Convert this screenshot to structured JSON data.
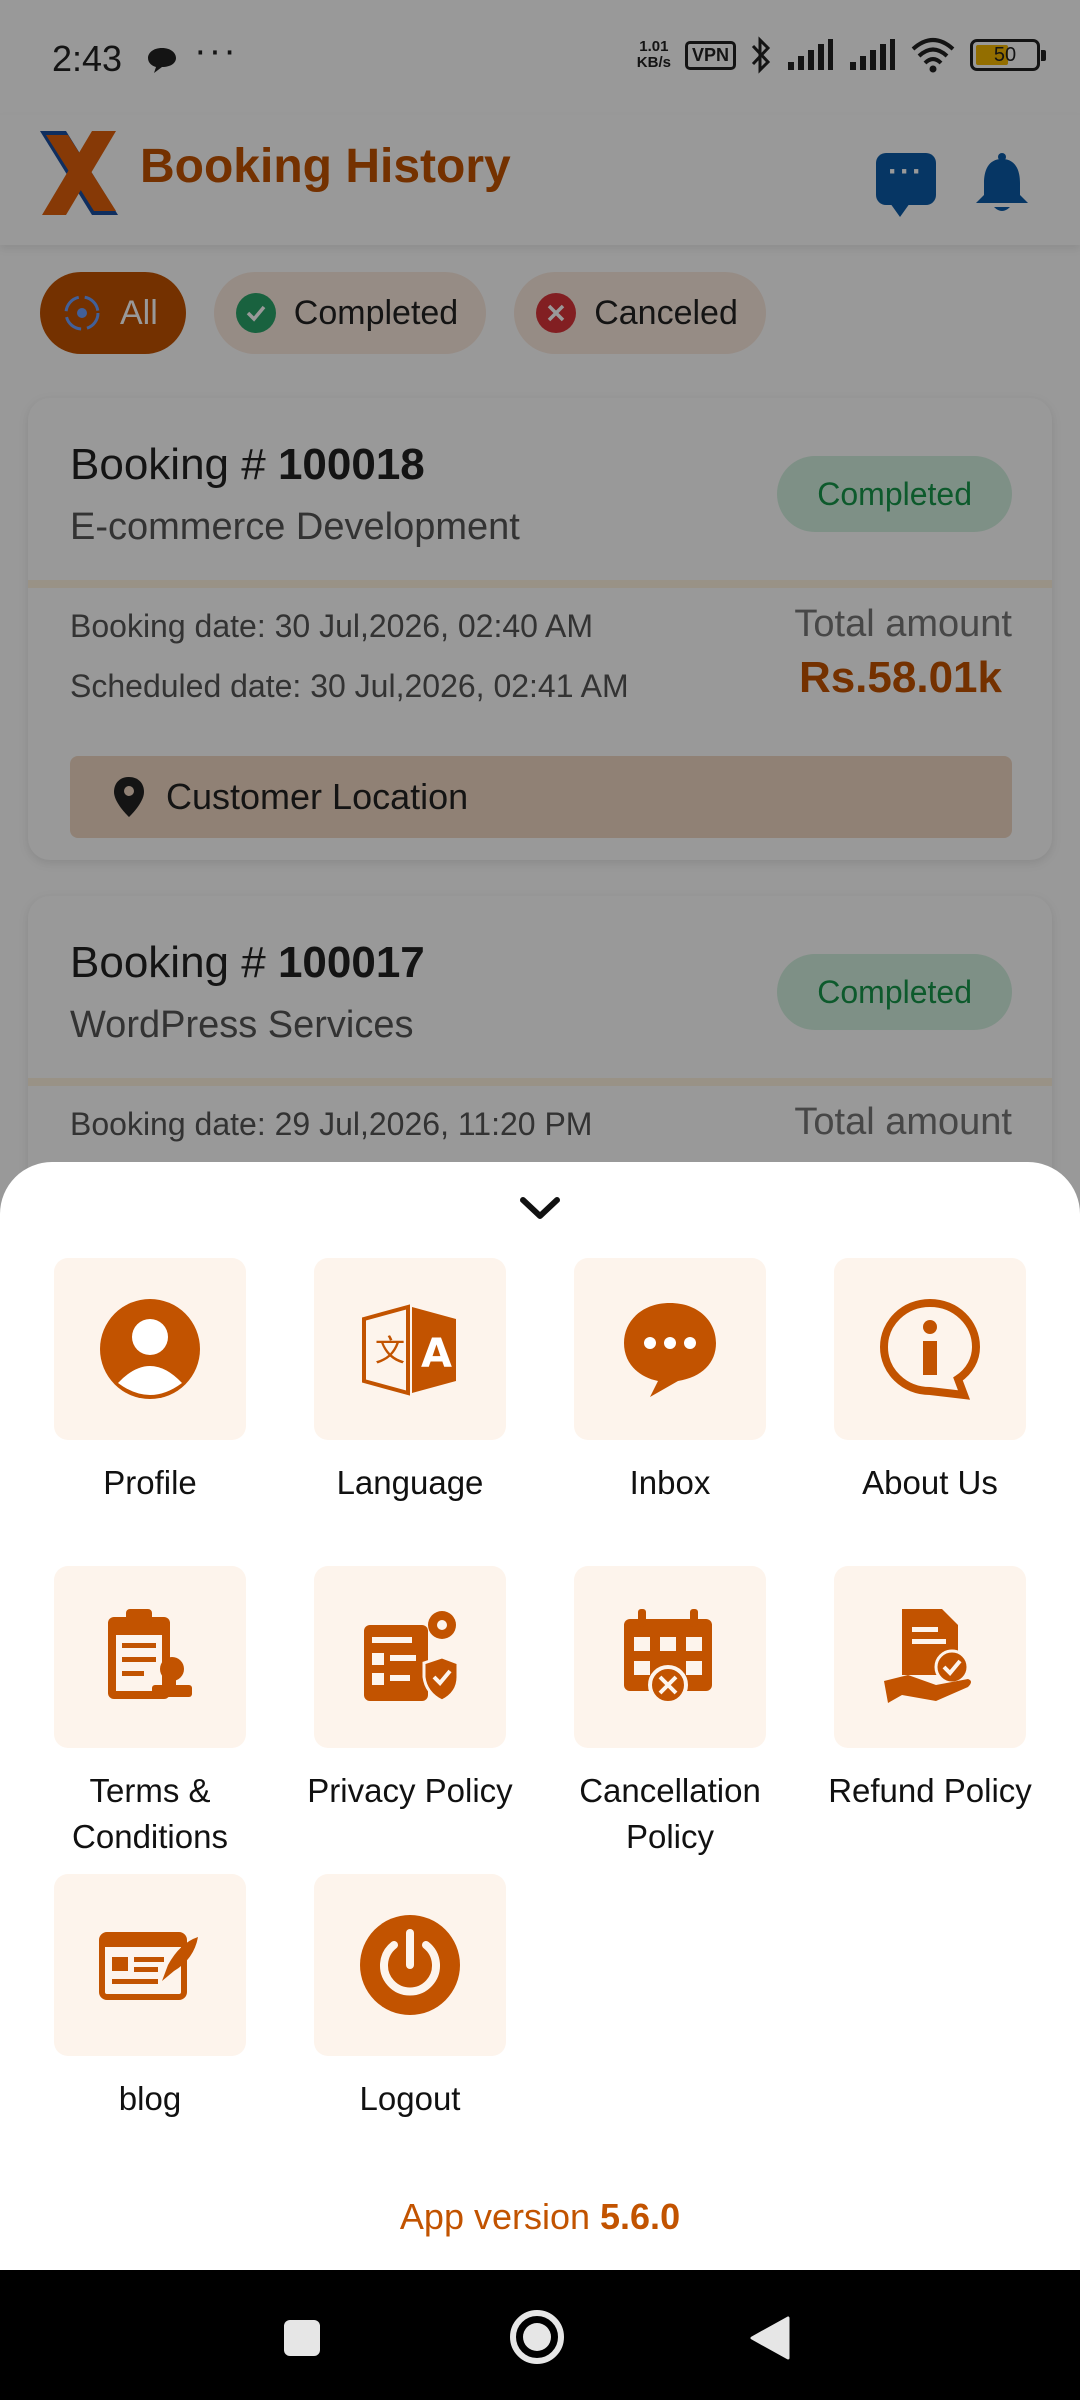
{
  "status_bar": {
    "time": "2:43",
    "more": "···",
    "net_speed_value": "1.01",
    "net_speed_unit": "KB/s",
    "vpn": "VPN",
    "battery": "50"
  },
  "header": {
    "title": "Booking History",
    "chat_icon": "chat-bubble-icon",
    "bell_icon": "bell-icon"
  },
  "filters": [
    {
      "label": "All",
      "icon": "refresh-icon",
      "active": true
    },
    {
      "label": "Completed",
      "icon": "check-circle-icon",
      "active": false
    },
    {
      "label": "Canceled",
      "icon": "x-circle-icon",
      "active": false
    }
  ],
  "bookings": [
    {
      "prefix": "Booking # ",
      "number": "100018",
      "service": "E-commerce Development",
      "status": "Completed",
      "booking_date": "Booking date:  30 Jul,2026, 02:40 AM",
      "scheduled_date": "Scheduled date: 30 Jul,2026, 02:41 AM",
      "total_label": "Total amount",
      "total_value": "Rs.58.01k",
      "location": "Customer Location"
    },
    {
      "prefix": "Booking # ",
      "number": "100017",
      "service": "WordPress Services",
      "status": "Completed",
      "booking_date": "Booking date:  29 Jul,2026, 11:20 PM",
      "total_label": "Total amount"
    }
  ],
  "menu": {
    "items": [
      {
        "label": "Profile",
        "icon": "profile-icon"
      },
      {
        "label": "Language",
        "icon": "language-icon"
      },
      {
        "label": "Inbox",
        "icon": "inbox-icon"
      },
      {
        "label": "About Us",
        "icon": "info-icon"
      },
      {
        "label": "Terms & Conditions",
        "icon": "clipboard-icon"
      },
      {
        "label": "Privacy Policy",
        "icon": "privacy-icon"
      },
      {
        "label": "Cancellation Policy",
        "icon": "calendar-cancel-icon"
      },
      {
        "label": "Refund Policy",
        "icon": "refund-icon"
      },
      {
        "label": "blog",
        "icon": "blog-icon"
      },
      {
        "label": "Logout",
        "icon": "power-icon"
      }
    ],
    "version_label": "App version ",
    "version": "5.6.0"
  },
  "colors": {
    "brand": "#c25300",
    "accent_blue": "#0b5ba7",
    "success": "#17964a",
    "danger": "#d9343a"
  }
}
